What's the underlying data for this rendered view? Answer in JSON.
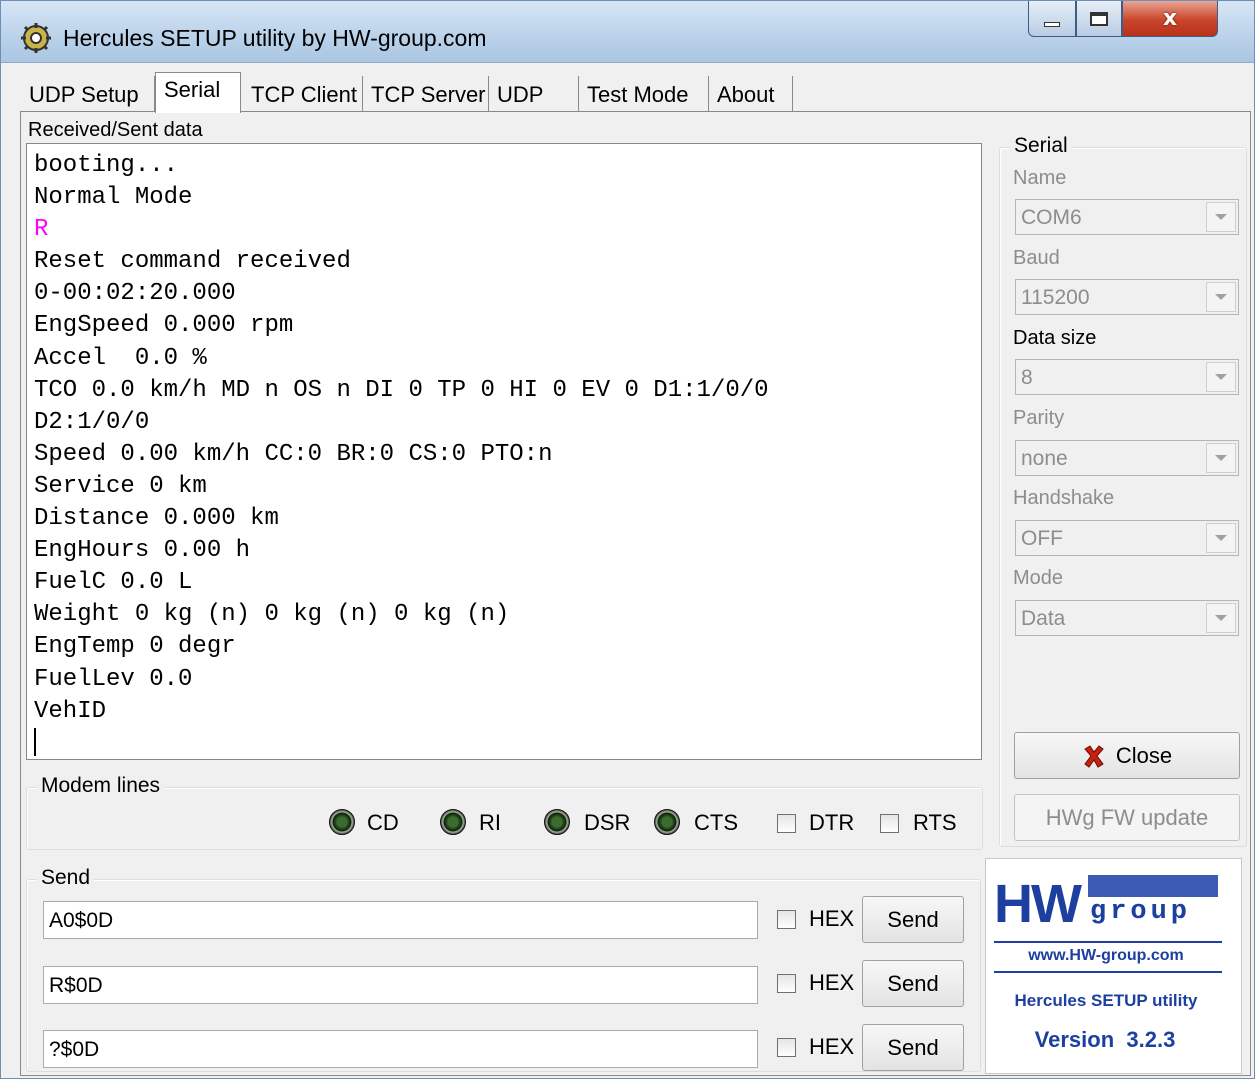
{
  "window": {
    "title": "Hercules SETUP utility by HW-group.com",
    "title_icon": "hercules-icon",
    "caption_buttons": {
      "minimize": "minimize-icon",
      "maximize": "maximize-icon",
      "close": "x"
    }
  },
  "tabs": [
    {
      "label": "UDP Setup"
    },
    {
      "label": "Serial"
    },
    {
      "label": "TCP Client"
    },
    {
      "label": "TCP Server"
    },
    {
      "label": "UDP"
    },
    {
      "label": "Test Mode"
    },
    {
      "label": "About"
    }
  ],
  "received": {
    "label": "Received/Sent data",
    "lines": [
      "booting...",
      "Normal Mode",
      "R",
      "Reset command received",
      "0-00:02:20.000",
      "EngSpeed 0.000 rpm",
      "Accel  0.0 %",
      "TCO 0.0 km/h MD n OS n DI 0 TP 0 HI 0 EV 0 D1:1/0/0",
      "D2:1/0/0",
      "Speed 0.00 km/h CC:0 BR:0 CS:0 PTO:n",
      "Service 0 km",
      "Distance 0.000 km",
      "EngHours 0.00 h",
      "FuelC 0.0 L",
      "Weight 0 kg (n) 0 kg (n) 0 kg (n)",
      "EngTemp 0 degr",
      "FuelLev 0.0",
      "VehID"
    ],
    "highlight_color": "#ff00ff"
  },
  "modem": {
    "title": "Modem lines",
    "leds": [
      {
        "label": "CD"
      },
      {
        "label": "RI"
      },
      {
        "label": "DSR"
      },
      {
        "label": "CTS"
      }
    ],
    "checks": [
      {
        "label": "DTR",
        "checked": false
      },
      {
        "label": "RTS",
        "checked": false
      }
    ]
  },
  "serial": {
    "title": "Serial",
    "name_label": "Name",
    "name_value": "COM6",
    "baud_label": "Baud",
    "baud_value": "115200",
    "datasize_label": "Data size",
    "datasize_value": "8",
    "parity_label": "Parity",
    "parity_value": "none",
    "handshake_label": "Handshake",
    "handshake_value": "OFF",
    "mode_label": "Mode",
    "mode_value": "Data",
    "close_label": "Close",
    "close_icon": "red-x-icon",
    "fw_label": "HWg FW update"
  },
  "send": {
    "title": "Send",
    "rows": [
      {
        "value": "A0$0D",
        "hex_label": "HEX",
        "hex_checked": false,
        "button": "Send"
      },
      {
        "value": "R$0D",
        "hex_label": "HEX",
        "hex_checked": false,
        "button": "Send"
      },
      {
        "value": "?$0D",
        "hex_label": "HEX",
        "hex_checked": false,
        "button": "Send"
      }
    ]
  },
  "logo": {
    "brand": "HW",
    "group": "group",
    "url": "www.HW-group.com",
    "product": "Hercules SETUP utility",
    "version": "Version  3.2.3",
    "brand_color": "#1c3fa0",
    "accent_color": "#3b5bb5"
  }
}
